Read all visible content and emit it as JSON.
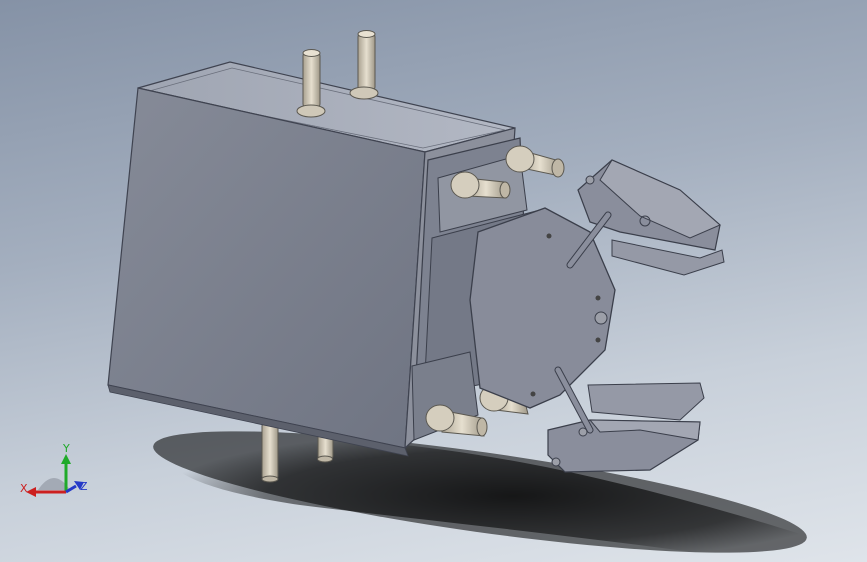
{
  "viewport": {
    "background_top": "#8592a6",
    "background_bottom": "#dfe4ea"
  },
  "model": {
    "body_color": "#7e8290",
    "gripper_color": "#8a8e9c",
    "fitting_color": "#c9c2b0"
  },
  "triad": {
    "x_label": "X",
    "y_label": "Y",
    "z_label": "Z",
    "x_color": "#cc1f1f",
    "y_color": "#1faa2a",
    "z_color": "#2438c8"
  }
}
